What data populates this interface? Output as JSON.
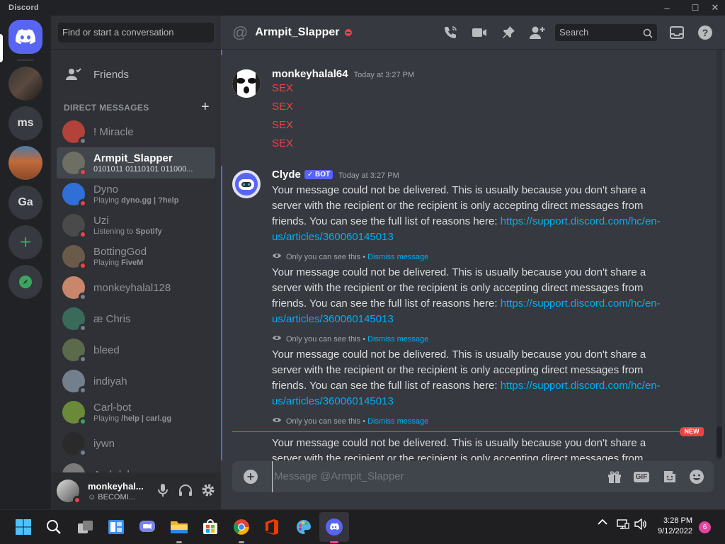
{
  "window": {
    "title": "Discord",
    "controls": [
      "–",
      "☐",
      "✕"
    ]
  },
  "guilds": [
    {
      "name": "home",
      "label": ""
    },
    {
      "name": "server-photo-1",
      "label": ""
    },
    {
      "name": "server-ms",
      "label": "ms"
    },
    {
      "name": "server-photo-2",
      "label": ""
    },
    {
      "name": "server-ga",
      "label": "Ga"
    },
    {
      "name": "add-server",
      "label": "+"
    },
    {
      "name": "explore",
      "label": ""
    }
  ],
  "sidebar": {
    "search_placeholder": "Find or start a conversation",
    "friends_label": "Friends",
    "dm_header": "DIRECT MESSAGES",
    "dm_add": "+",
    "dms": [
      {
        "name": "! Miracle",
        "sub": "",
        "sub_bold": "",
        "status": "off",
        "color": "#b3423a"
      },
      {
        "name": "Armpit_Slapper",
        "sub": "0101011 01110101 011000...",
        "sub_bold": "",
        "status": "dnd",
        "color": "#6d6f63",
        "active": true
      },
      {
        "name": "Dyno",
        "sub": "Playing ",
        "sub_bold": "dyno.gg | ?help",
        "status": "dnd",
        "color": "#2f6fd6"
      },
      {
        "name": "Uzi",
        "sub": "Listening to ",
        "sub_bold": "Spotify",
        "status": "dnd",
        "color": "#4a4a4a"
      },
      {
        "name": "BottingGod",
        "sub": "Playing ",
        "sub_bold": "FiveM",
        "status": "dnd",
        "color": "#6a5a4a"
      },
      {
        "name": "monkeyhalal128",
        "sub": "",
        "sub_bold": "",
        "status": "off",
        "color": "#c9866a"
      },
      {
        "name": "æ Chris",
        "sub": "",
        "sub_bold": "",
        "status": "off",
        "color": "#3a6a5a"
      },
      {
        "name": "bleed",
        "sub": "",
        "sub_bold": "",
        "status": "off",
        "color": "#5a6a4a"
      },
      {
        "name": "indiyah",
        "sub": "",
        "sub_bold": "",
        "status": "off",
        "color": "#747f8d"
      },
      {
        "name": "Carl-bot",
        "sub": "Playing ",
        "sub_bold": "/help | carl.gg",
        "status": "on",
        "color": "#6a8a3a"
      },
      {
        "name": "iywn",
        "sub": "",
        "sub_bold": "",
        "status": "off",
        "color": "#2a2a2a"
      },
      {
        "name": "Archduke",
        "sub": "",
        "sub_bold": "",
        "status": "off",
        "color": "#7a7a7a"
      }
    ]
  },
  "user_panel": {
    "name": "monkeyhal...",
    "status": "☺ BECOMI..."
  },
  "chat": {
    "channel_name": "Armpit_Slapper",
    "search_placeholder": "Search",
    "groups": {
      "g1": {
        "author": "monkeyhalal64",
        "time": "Today at 3:27 PM",
        "lines": [
          "SEX",
          "SEX",
          "SEX",
          "SEX"
        ]
      },
      "g2": {
        "author": "Clyde",
        "bot_tag": "✓ BOT",
        "time": "Today at 3:27 PM",
        "body": "Your message could not be delivered. This is usually because you don't share a server with the recipient or the recipient is only accepting direct messages from friends. You can see the full list of reasons here: ",
        "link": "https://support.discord.com/hc/en-us/articles/360060145013",
        "eph_text": "Only you can see this •",
        "eph_link": "Dismiss message"
      }
    },
    "new_badge": "NEW",
    "composer_placeholder": "Message @Armpit_Slapper"
  },
  "taskbar": {
    "time": "3:28 PM",
    "date": "9/12/2022",
    "notif_count": "6"
  }
}
